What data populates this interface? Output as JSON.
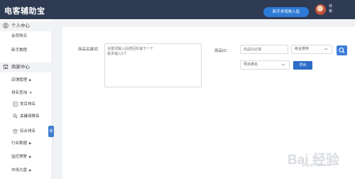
{
  "header": {
    "title": "电客辅助宝",
    "new_user_button": "新手多视角入驻",
    "user_name_lines": [
      "林",
      "第"
    ]
  },
  "sidebar": {
    "section_personal": "个人中心",
    "personal_items": [
      "会员购买",
      "新手教程"
    ],
    "section_tools": "商家中心",
    "tool_items": [
      {
        "label": "店铺管理",
        "caret": "▶"
      },
      {
        "label": "排名查询",
        "caret": "▼"
      },
      {
        "label": "类目排名",
        "caret": ""
      },
      {
        "label": "关键词排名",
        "caret": ""
      },
      {
        "label": "综合排名",
        "caret": ""
      },
      {
        "label": "行业数据",
        "caret": "▶"
      },
      {
        "label": "监控预警",
        "caret": "▶"
      },
      {
        "label": "市场大盘",
        "caret": "▶"
      }
    ],
    "collapse_tab": "收"
  },
  "form": {
    "keyword_label": "商品关键词：",
    "keyword_placeholder": "关键词输入后按回车输下一个\n最多输入5个",
    "id_label": "商品ID：",
    "id_placeholder": "商品ID必填",
    "sort_select": "综合排序",
    "export_select": "导出排名",
    "export_button": "导出"
  },
  "watermark": {
    "text": "jingyan.baidu.com"
  },
  "colors": {
    "topbar": "#2f3b52",
    "accent": "#2d7bd6"
  }
}
